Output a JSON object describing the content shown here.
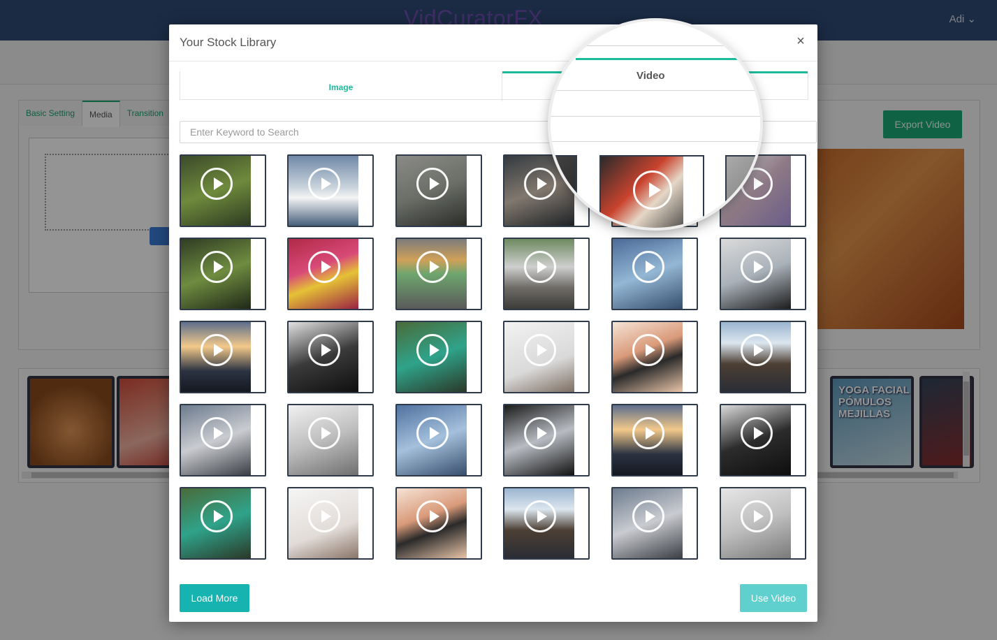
{
  "app": {
    "brand": "VidCuratorFX",
    "user": "Adi",
    "user_caret": "⌄"
  },
  "editor": {
    "tabs": [
      {
        "label": "Basic Setting"
      },
      {
        "label": "Media"
      },
      {
        "label": "Transition"
      }
    ],
    "export_label": "Export Video"
  },
  "timeline": {
    "yoga_line1": "YOGA FACIAL",
    "yoga_line2": "PÓMULOS",
    "yoga_line3": "MEJILLAS"
  },
  "modal": {
    "title": "Your Stock Library",
    "close": "×",
    "tabs": {
      "image": "Image",
      "video": "Video"
    },
    "search_placeholder": "Enter Keyword to Search",
    "load_more": "Load More",
    "use_video": "Use Video",
    "thumbs": [
      {
        "bg": "linear-gradient(160deg,#3b4a2a,#6f8a3c 50%,#2c3a22)"
      },
      {
        "bg": "linear-gradient(180deg,#7089a8,#c9d3dc 45%,#f4f4f4 60%,#48607c)"
      },
      {
        "bg": "linear-gradient(160deg,#8a8a86,#6b6f68 50%,#2a2c28)"
      },
      {
        "bg": "linear-gradient(160deg,#343a40,#81786e 50%,#1e2226)"
      },
      {
        "bg": "linear-gradient(135deg,#2a2a2a,#c9432e 40%,#e5d7c7 60%,#333)"
      },
      {
        "bg": "linear-gradient(135deg,#c8c8c8,#8e7a86 50%,#6a5c88)"
      },
      {
        "bg": "linear-gradient(160deg,#2f3c23,#6f8c40 50%,#1f2818)"
      },
      {
        "bg": "linear-gradient(160deg,#b02a46,#d84a78 40%,#e5c236 60%,#9b2243)"
      },
      {
        "bg": "linear-gradient(180deg,#7c7c7c,#d0a058 30%,#6ea56e 50%,#5a5a5a)"
      },
      {
        "bg": "linear-gradient(180deg,#6e8a60,#cfcfcf 40%,#6e6b66 70%,#3d3c39)"
      },
      {
        "bg": "linear-gradient(160deg,#4c6b9a,#93b7d4 50%,#364e6e)"
      },
      {
        "bg": "linear-gradient(160deg,#dadada,#a9b1b9 50%,#1c1c1c)"
      },
      {
        "bg": "linear-gradient(180deg,#5d6f8c,#f3c98a 35%,#2b3342 70%,#141820)"
      },
      {
        "bg": "linear-gradient(160deg,#e1e1e1,#3a3a3a 50%,#0f0f0f)"
      },
      {
        "bg": "linear-gradient(160deg,#4a6b3a,#2fa38a 50%,#2b3828)"
      },
      {
        "bg": "linear-gradient(160deg,#f2f2f2,#d9d9d9 60%,#7d6e62)"
      },
      {
        "bg": "linear-gradient(160deg,#f5e3d5,#d99a7a 40%,#2a2a2a 60%,#e8c4a8)"
      },
      {
        "bg": "linear-gradient(180deg,#9bb5d0,#dce6ee 30%,#4c3f34 60%,#2a2d35)"
      },
      {
        "bg": "linear-gradient(160deg,#6d7c8e,#c9cbd0 50%,#3b3e44)"
      },
      {
        "bg": "linear-gradient(160deg,#f1f1f1,#bdbdbd 50%,#6f6f6f)"
      },
      {
        "bg": "linear-gradient(160deg,#5072a0,#a5c0dc 50%,#374e6c)"
      },
      {
        "bg": "linear-gradient(160deg,#1c1c1c,#b8bcc2 50%,#121212)"
      },
      {
        "bg": "linear-gradient(180deg,#5d6f8c,#f3c98a 35%,#2b3342 70%,#141820)"
      },
      {
        "bg": "linear-gradient(160deg,#dadada,#2c2c2c 50%,#0e0e0e)"
      },
      {
        "bg": "linear-gradient(160deg,#4a6b3a,#2fa38a 50%,#2b3828)"
      },
      {
        "bg": "linear-gradient(160deg,#f5f5f5,#e2dcd8 60%,#8a7568)"
      },
      {
        "bg": "linear-gradient(160deg,#f5e3d5,#d99a7a 40%,#2a2a2a 60%,#e8c4a8)"
      },
      {
        "bg": "linear-gradient(180deg,#9bb5d0,#dce6ee 30%,#4c3f34 60%,#2a2d35)"
      },
      {
        "bg": "linear-gradient(160deg,#6d7c8e,#c9cbd0 50%,#3b3e44)"
      },
      {
        "bg": "linear-gradient(160deg,#e6e6e6,#bfbfbf 50%,#7a7a7a)"
      }
    ]
  }
}
